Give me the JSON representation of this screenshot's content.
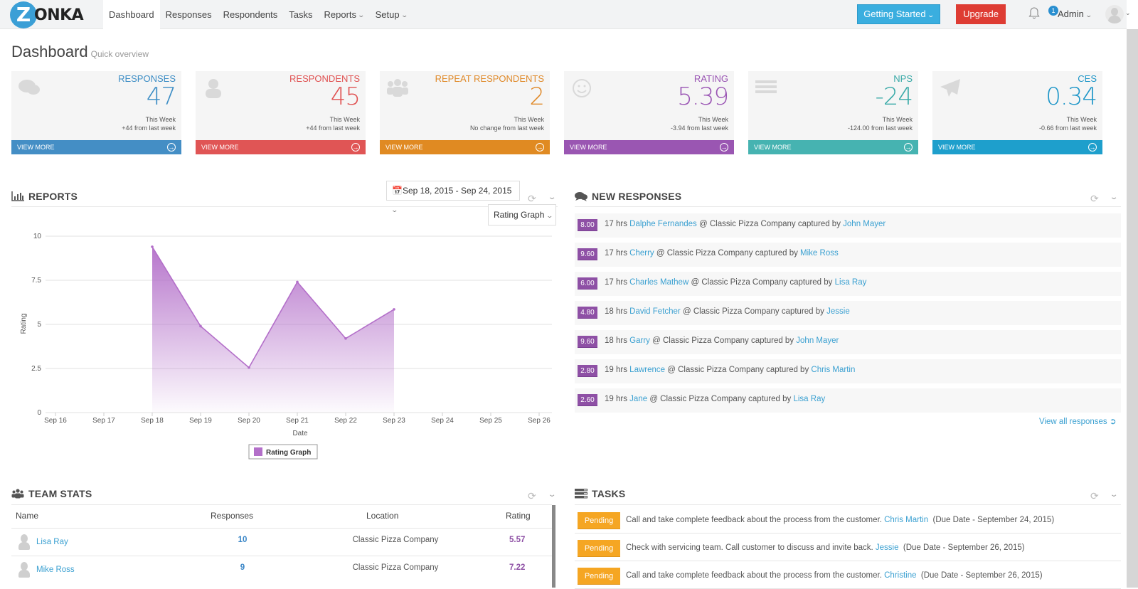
{
  "nav": {
    "logo_letter": "Z",
    "logo_text": "ONKA",
    "items": [
      {
        "label": "Dashboard",
        "active": true,
        "dropdown": false
      },
      {
        "label": "Responses",
        "active": false,
        "dropdown": false
      },
      {
        "label": "Respondents",
        "active": false,
        "dropdown": false
      },
      {
        "label": "Tasks",
        "active": false,
        "dropdown": false
      },
      {
        "label": "Reports",
        "active": false,
        "dropdown": true
      },
      {
        "label": "Setup",
        "active": false,
        "dropdown": true
      }
    ],
    "getting_started": "Getting Started",
    "upgrade": "Upgrade",
    "notification_count": "1",
    "admin_label": "Admin"
  },
  "page": {
    "title": "Dashboard",
    "subtitle": "Quick overview"
  },
  "cards": [
    {
      "label": "RESPONSES",
      "value": "47",
      "period": "This Week",
      "change": "+44 from last week",
      "color": "#3c8dc5",
      "bar_color": "#448ec5",
      "icon": "comments-icon",
      "view_more": "VIEW MORE"
    },
    {
      "label": "RESPONDENTS",
      "value": "45",
      "period": "This Week",
      "change": "+44 from last week",
      "color": "#e05252",
      "bar_color": "#e05555",
      "icon": "user-icon",
      "view_more": "VIEW MORE"
    },
    {
      "label": "REPEAT RESPONDENTS",
      "value": "2",
      "period": "This Week",
      "change": "No change from last week",
      "color": "#e08a2a",
      "bar_color": "#e08a22",
      "icon": "users-icon",
      "view_more": "VIEW MORE"
    },
    {
      "label": "RATING",
      "value": "5.39",
      "period": "This Week",
      "change": "-3.94 from last week",
      "color": "#9a55b4",
      "bar_color": "#9a56b2",
      "icon": "smile-icon",
      "view_more": "VIEW MORE"
    },
    {
      "label": "NPS",
      "value": "-24",
      "period": "This Week",
      "change": "-124.00 from last week",
      "color": "#3aaaa8",
      "bar_color": "#46b3b1",
      "icon": "list-icon",
      "view_more": "VIEW MORE"
    },
    {
      "label": "CES",
      "value": "0.34",
      "period": "This Week",
      "change": "-0.66 from last week",
      "color": "#1e96c8",
      "bar_color": "#1e9fcc",
      "icon": "paper-plane-icon",
      "view_more": "VIEW MORE"
    }
  ],
  "reports": {
    "title": "REPORTS",
    "date_range": "Sep 18, 2015 - Sep 24, 2015",
    "graph_select": "Rating Graph"
  },
  "chart_data": {
    "type": "area",
    "title": "",
    "xlabel": "Date",
    "ylabel": "Rating",
    "ylim": [
      0,
      10
    ],
    "yticks": [
      0,
      2.5,
      5,
      7.5,
      10
    ],
    "ytick_labels": [
      "0",
      "2.5",
      "5",
      "7.5",
      "10"
    ],
    "categories": [
      "Sep 16",
      "Sep 17",
      "Sep 18",
      "Sep 19",
      "Sep 20",
      "Sep 21",
      "Sep 22",
      "Sep 23",
      "Sep 24",
      "Sep 25",
      "Sep 26"
    ],
    "series": [
      {
        "name": "Rating Graph",
        "color": "#b36fc9",
        "values": [
          null,
          null,
          9.4,
          4.9,
          2.55,
          7.4,
          4.2,
          5.85,
          null,
          null,
          null
        ]
      }
    ],
    "grid": true,
    "legend": "bottom-center"
  },
  "new_responses": {
    "title": "NEW RESPONSES",
    "items": [
      {
        "score": "8.00",
        "time": "17 hrs",
        "name": "Dalphe Fernandes",
        "location": "@ Classic Pizza Company captured by",
        "by": "John Mayer"
      },
      {
        "score": "9.60",
        "time": "17 hrs",
        "name": "Cherry",
        "location": "@ Classic Pizza Company captured by",
        "by": "Mike Ross"
      },
      {
        "score": "6.00",
        "time": "17 hrs",
        "name": "Charles Mathew",
        "location": "@ Classic Pizza Company captured by",
        "by": "Lisa Ray"
      },
      {
        "score": "4.80",
        "time": "18 hrs",
        "name": "David Fetcher",
        "location": "@ Classic Pizza Company captured by",
        "by": "Jessie"
      },
      {
        "score": "9.60",
        "time": "18 hrs",
        "name": "Garry",
        "location": "@ Classic Pizza Company captured by",
        "by": "John Mayer"
      },
      {
        "score": "2.80",
        "time": "19 hrs",
        "name": "Lawrence",
        "location": "@ Classic Pizza Company captured by",
        "by": "Chris Martin"
      },
      {
        "score": "2.60",
        "time": "19 hrs",
        "name": "Jane",
        "location": "@ Classic Pizza Company captured by",
        "by": "Lisa Ray"
      }
    ],
    "view_all": "View all responses"
  },
  "team_stats": {
    "title": "TEAM STATS",
    "columns": [
      "Name",
      "Responses",
      "Location",
      "Rating"
    ],
    "rows": [
      {
        "name": "Lisa Ray",
        "responses": "10",
        "location": "Classic Pizza Company",
        "rating": "5.57"
      },
      {
        "name": "Mike Ross",
        "responses": "9",
        "location": "Classic Pizza Company",
        "rating": "7.22"
      }
    ]
  },
  "tasks": {
    "title": "TASKS",
    "items": [
      {
        "status": "Pending",
        "text": "Call and take complete feedback about the process from the customer.",
        "assignee": "Chris Martin",
        "due": "(Due Date - September 24, 2015)"
      },
      {
        "status": "Pending",
        "text": "Check with servicing team. Call customer to discuss and invite back.",
        "assignee": "Jessie",
        "due": "(Due Date - September 26, 2015)"
      },
      {
        "status": "Pending",
        "text": "Call and take complete feedback about the process from the customer.",
        "assignee": "Christine",
        "due": "(Due Date - September 26, 2015)"
      }
    ]
  }
}
